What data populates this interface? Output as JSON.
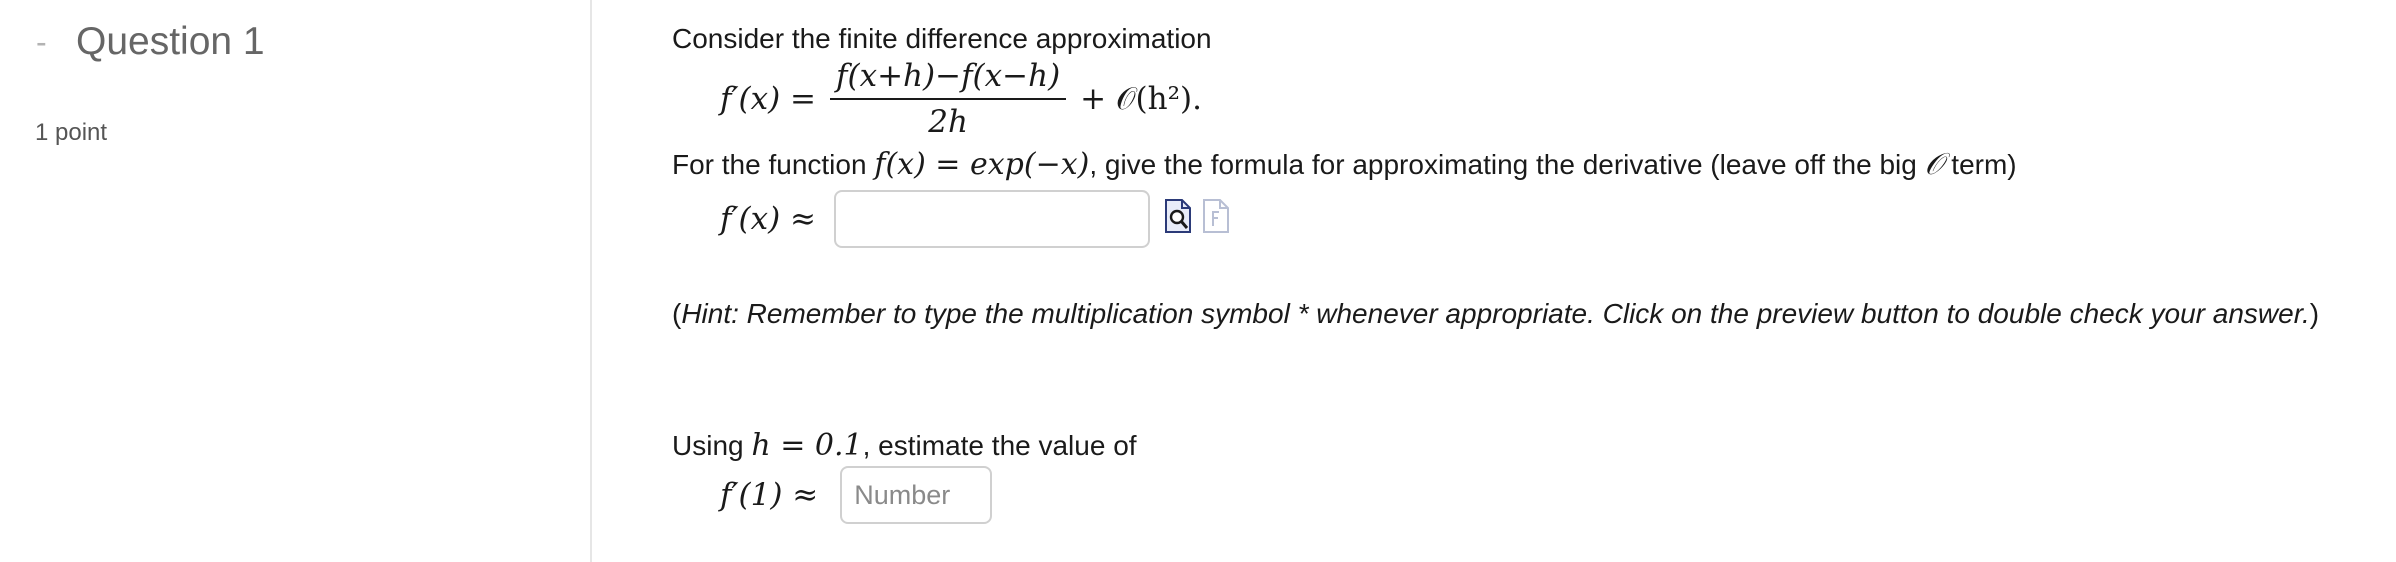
{
  "question": {
    "collapse_symbol": "-",
    "title": "Question 1",
    "points": "1 point"
  },
  "problem": {
    "intro": "Consider the finite difference approximation",
    "approximation": {
      "lhs": "f′(x) =",
      "numerator": "f(x+h)−f(x−h)",
      "denominator": "2h",
      "error_term": "+ 𝒪(h²)."
    },
    "function_prompt": {
      "before": "For the function ",
      "function_math": "f(x) = exp(−x)",
      "after": ", give the formula for approximating the derivative (leave off the big ",
      "bigO": "𝒪",
      "end": " term)"
    },
    "formula_row": {
      "label": "f′(x) ≈",
      "input_value": "",
      "preview_icon": "preview-magnifier-icon",
      "formula_icon": "formula-editor-icon"
    },
    "hint": {
      "open": "(",
      "text": "Hint: Remember to type the multiplication symbol * whenever appropriate. Click on the preview button to double check your answer.",
      "close": ")"
    },
    "estimate_prompt": {
      "before": "Using ",
      "h_math": "h = 0.1",
      "after": ", estimate the value of"
    },
    "estimate_row": {
      "label": "f′(1) ≈",
      "placeholder": "Number",
      "input_value": ""
    }
  }
}
